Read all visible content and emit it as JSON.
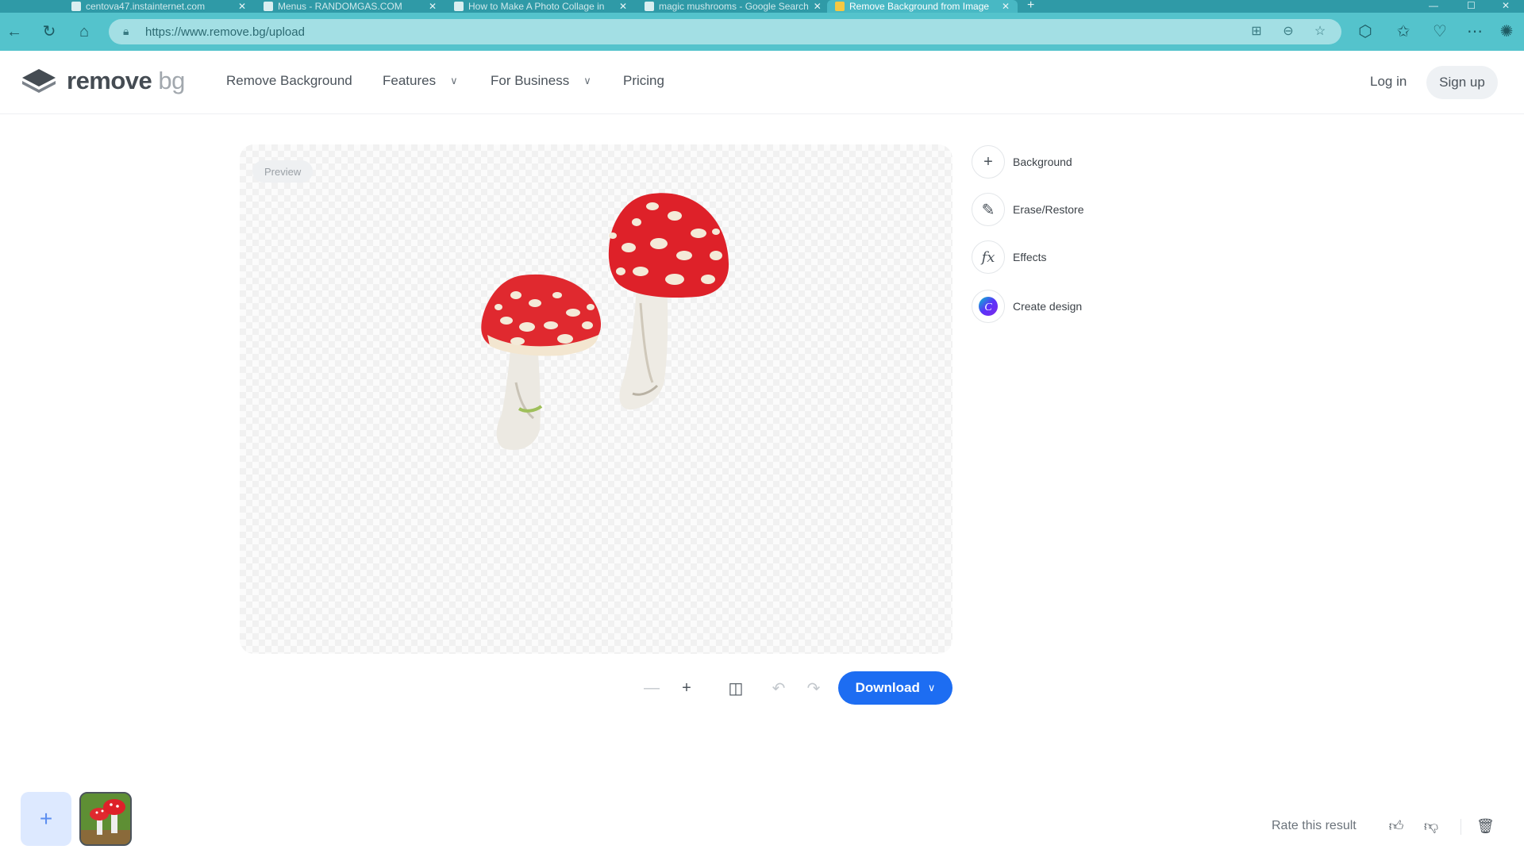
{
  "browser": {
    "tabs": [
      {
        "label": "centova47.instainternet.com"
      },
      {
        "label": "Menus - RANDOMGAS.COM"
      },
      {
        "label": "How to Make A Photo Collage in"
      },
      {
        "label": "magic mushrooms - Google Search"
      },
      {
        "label": "Remove Background from Image"
      }
    ],
    "url": "https://www.remove.bg/upload"
  },
  "header": {
    "logo_main": "remove",
    "logo_suffix": "bg",
    "nav": {
      "remove_background": "Remove Background",
      "features": "Features",
      "for_business": "For Business",
      "pricing": "Pricing"
    },
    "login": "Log in",
    "signup": "Sign up"
  },
  "editor": {
    "preview_badge": "Preview",
    "tools": [
      {
        "label": "Background",
        "icon": "plus-icon"
      },
      {
        "label": "Erase/Restore",
        "icon": "brush-icon"
      },
      {
        "label": "Effects",
        "icon": "fx-icon"
      },
      {
        "label": "Create design",
        "icon": "canva-icon"
      }
    ],
    "download_label": "Download"
  },
  "footer": {
    "rate_label": "Rate this result"
  },
  "colors": {
    "accent": "#1d6df2",
    "browser_toolbar": "#54c3cc",
    "tabbar": "#2f9aa7"
  }
}
